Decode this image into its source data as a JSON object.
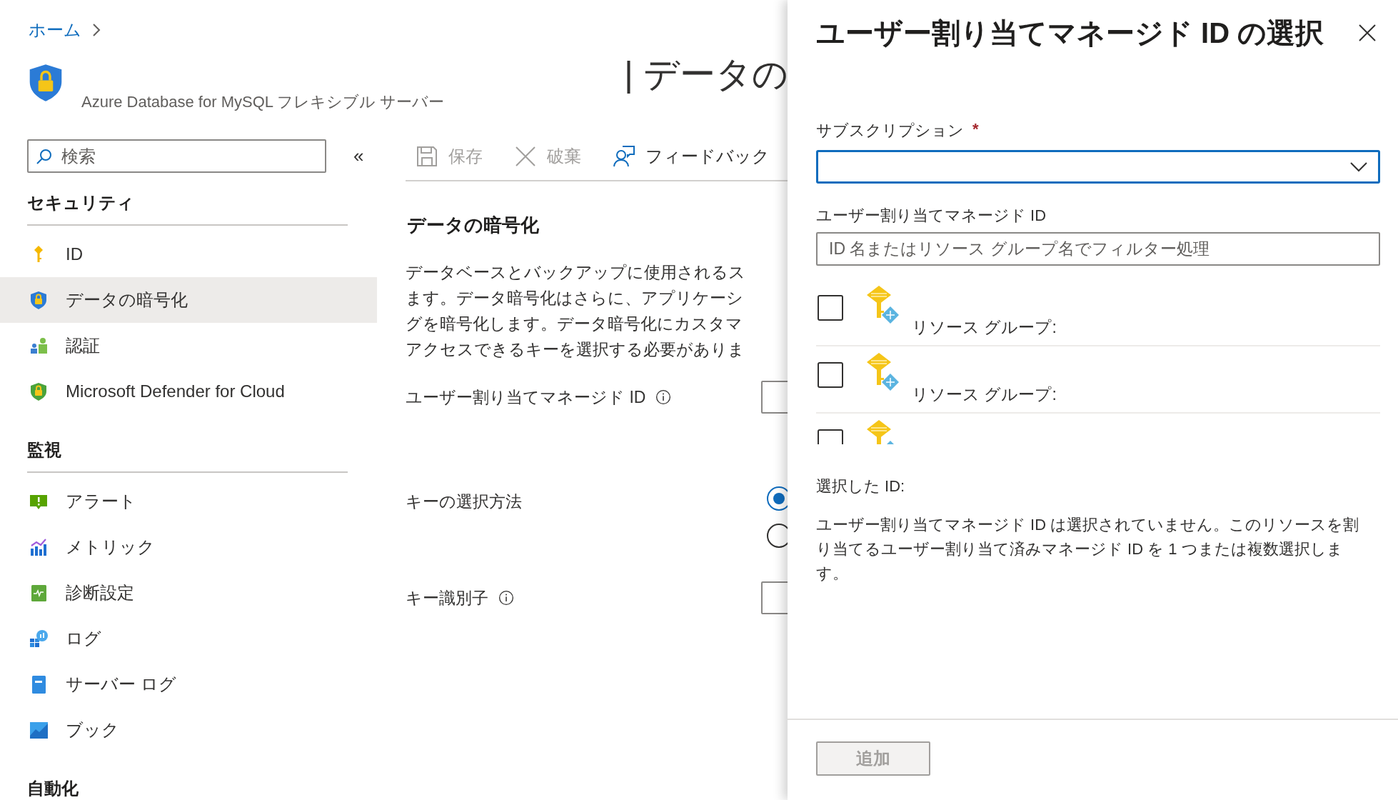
{
  "breadcrumb": [
    {
      "label": "ホーム"
    }
  ],
  "resource": {
    "title": "| データの",
    "subtitle": "Azure Database for MySQL フレキシブル サーバー"
  },
  "sidebar": {
    "search": {
      "placeholder": "検索"
    },
    "collapse": "«",
    "sections": [
      {
        "title": "セキュリティ",
        "items": [
          {
            "label": "ID",
            "selected": false
          },
          {
            "label": "データの暗号化",
            "selected": true
          },
          {
            "label": "認証",
            "selected": false
          },
          {
            "label": "Microsoft Defender for Cloud",
            "selected": false
          }
        ]
      },
      {
        "title": "監視",
        "items": [
          {
            "label": "アラート",
            "selected": false
          },
          {
            "label": "メトリック",
            "selected": false
          },
          {
            "label": "診断設定",
            "selected": false
          },
          {
            "label": "ログ",
            "selected": false
          },
          {
            "label": "サーバー ログ",
            "selected": false
          },
          {
            "label": "ブック",
            "selected": false
          }
        ]
      },
      {
        "title": "自動化"
      }
    ]
  },
  "toolbar": [
    {
      "label": "保存",
      "disabled": true
    },
    {
      "label": "破棄",
      "disabled": true
    },
    {
      "label": "フィードバック",
      "disabled": false
    }
  ],
  "content": {
    "heading": "データの暗号化",
    "description_lines": [
      "データベースとバックアップに使用されるス",
      "ます。データ暗号化はさらに、アプリケーシ",
      "グを暗号化します。データ暗号化にカスタマ",
      "アクセスできるキーを選択する必要がありま"
    ],
    "fields": [
      {
        "kind": "input",
        "label": "ユーザー割り当てマネージド ID",
        "info": true
      },
      {
        "kind": "radio",
        "label": "キーの選択方法",
        "info": false,
        "options": [
          {
            "selected": true
          },
          {
            "selected": false
          }
        ]
      },
      {
        "kind": "input",
        "label": "キー識別子",
        "info": true
      }
    ]
  },
  "panel": {
    "title": "ユーザー割り当てマネージド ID の選択",
    "subscription": {
      "label": "サブスクリプション",
      "required_mark": "*"
    },
    "filter": {
      "label": "ユーザー割り当てマネージド ID",
      "placeholder": "ID 名またはリソース グループ名でフィルター処理"
    },
    "identities": [
      {
        "resource_group": "リソース グループ:",
        "checked": false
      },
      {
        "resource_group": "リソース グループ:",
        "checked": false
      },
      {
        "checked": false
      }
    ],
    "selected_label": "選択した ID:",
    "selected_note": "ユーザー割り当てマネージド ID は選択されていません。このリソースを割り当てるユーザー割り当て済みマネージド ID を 1 つまたは複数選択します。",
    "add_button": {
      "label": "追加",
      "disabled": true
    }
  }
}
